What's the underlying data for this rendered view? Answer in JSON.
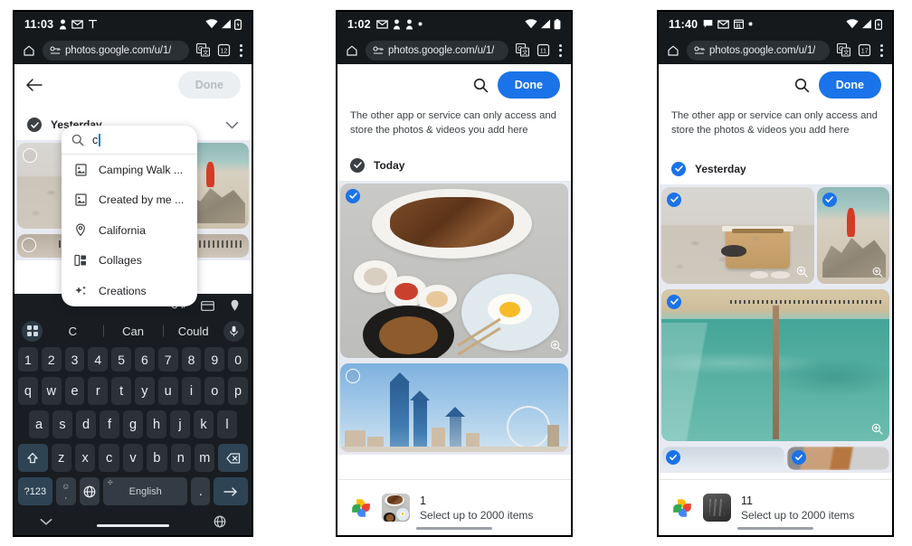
{
  "panels": [
    {
      "id": "panel-search-keyboard",
      "status_bar": {
        "time": "11:03",
        "left_icons": [
          "person-icon",
          "gmail-icon",
          "signal-tower-icon"
        ],
        "right_icons": [
          "wifi-icon",
          "cell-signal-icon",
          "battery-icon"
        ]
      },
      "browser": {
        "home_icon": "home-icon",
        "lock_icon": "permissions-icon",
        "url": "photos.google.com/u/1/",
        "translate_icon": "google-translate-icon",
        "tabs_icon": "tab-count-icon",
        "tabs_count": "12",
        "menu_icon": "three-dot-menu-icon"
      },
      "header": {
        "back_icon": "back-arrow-icon",
        "done_label": "Done",
        "done_enabled": false
      },
      "search": {
        "search_icon": "search-icon",
        "query": "c",
        "suggestions": [
          {
            "icon": "photo-frame-icon",
            "label": "Camping Walk ..."
          },
          {
            "icon": "photo-frame-icon",
            "label": "Created by me ..."
          },
          {
            "icon": "location-pin-icon",
            "label": "California"
          },
          {
            "icon": "collage-icon",
            "label": "Collages"
          },
          {
            "icon": "sparkle-icon",
            "label": "Creations"
          }
        ]
      },
      "day": {
        "label": "Yesterday",
        "selected": false,
        "chevron_icon": "chevron-down-icon"
      },
      "keyboard": {
        "strip_icons": [
          "key-password-icon",
          "card-icon",
          "location-pin-icon"
        ],
        "apps_icon": "keyboard-apps-icon",
        "mic_icon": "microphone-icon",
        "suggestions": [
          "C",
          "Can",
          "Could"
        ],
        "rows": [
          [
            "1",
            "2",
            "3",
            "4",
            "5",
            "6",
            "7",
            "8",
            "9",
            "0"
          ],
          [
            "q",
            "w",
            "e",
            "r",
            "t",
            "y",
            "u",
            "i",
            "o",
            "p"
          ],
          [
            "a",
            "s",
            "d",
            "f",
            "g",
            "h",
            "j",
            "k",
            "l"
          ],
          [
            "z",
            "x",
            "c",
            "v",
            "b",
            "n",
            "m"
          ]
        ],
        "shift_icon": "shift-arrow-icon",
        "backspace_icon": "backspace-icon",
        "symbols_label": "?123",
        "comma_label": ",",
        "globe_icon": "globe-icon",
        "space_label": "English",
        "period_label": ".",
        "enter_icon": "enter-arrow-icon",
        "nav_back_icon": "keyboard-hide-icon",
        "nav_globe_icon": "globe-icon"
      }
    },
    {
      "id": "panel-today-one-selected",
      "status_bar": {
        "time": "1:02",
        "left_icons": [
          "gmail-icon",
          "person-icon",
          "person-icon",
          "dot-icon"
        ],
        "right_icons": [
          "wifi-icon",
          "cell-signal-icon",
          "battery-icon"
        ]
      },
      "browser": {
        "home_icon": "home-icon",
        "lock_icon": "permissions-icon",
        "url": "photos.google.com/u/1/",
        "translate_icon": "google-translate-icon",
        "tabs_icon": "tab-count-icon",
        "tabs_count": "11",
        "menu_icon": "three-dot-menu-icon"
      },
      "header": {
        "search_icon": "search-icon",
        "done_label": "Done",
        "done_enabled": true
      },
      "notice": "The other app or service can only access and store the photos & videos you add here",
      "day": {
        "label": "Today",
        "selected": true,
        "selected_style": "dark"
      },
      "photos": [
        {
          "art": "art-food",
          "selected": true,
          "zoom_icon": "zoom-in-icon"
        },
        {
          "art": "art-city",
          "selected": false,
          "zoom_icon": "zoom-in-icon"
        }
      ],
      "bottom": {
        "logo": "google-photos-logo",
        "thumb_art": "art-food",
        "count": "1",
        "subtitle": "Select up to 2000 items"
      }
    },
    {
      "id": "panel-yesterday-all-selected",
      "status_bar": {
        "time": "11:40",
        "left_icons": [
          "message-icon",
          "gmail-icon",
          "calendar-icon",
          "dot-icon"
        ],
        "right_icons": [
          "wifi-icon",
          "cell-signal-icon",
          "battery-icon"
        ]
      },
      "browser": {
        "home_icon": "home-icon",
        "lock_icon": "permissions-icon",
        "url": "photos.google.com/u/1/",
        "translate_icon": "google-translate-icon",
        "tabs_icon": "tab-count-icon",
        "tabs_count": "17",
        "menu_icon": "three-dot-menu-icon"
      },
      "header": {
        "search_icon": "search-icon",
        "done_label": "Done",
        "done_enabled": true
      },
      "notice": "The other app or service can only access and store the photos & videos you add here",
      "day": {
        "label": "Yesterday",
        "selected": true,
        "selected_style": "blue"
      },
      "photos": [
        {
          "art": "art-beachbag",
          "selected": true,
          "zoom_icon": "zoom-in-icon"
        },
        {
          "art": "art-rocks",
          "selected": true,
          "zoom_icon": "zoom-in-icon"
        },
        {
          "art": "art-pier",
          "selected": true,
          "zoom_icon": "zoom-in-icon"
        },
        {
          "art": "art-blur-sky",
          "selected": true
        },
        {
          "art": "art-blur-food",
          "selected": true
        }
      ],
      "bottom": {
        "logo": "google-photos-logo",
        "thumb_art": "art-dark",
        "count": "11",
        "subtitle": "Select up to 2000 items"
      }
    }
  ],
  "colors": {
    "accent_blue": "#1a73e8",
    "status_bar_bg": "#15191c",
    "grid_bg": "#e8eaf2",
    "keyboard_bg": "#191d21",
    "text_primary": "#202124"
  }
}
